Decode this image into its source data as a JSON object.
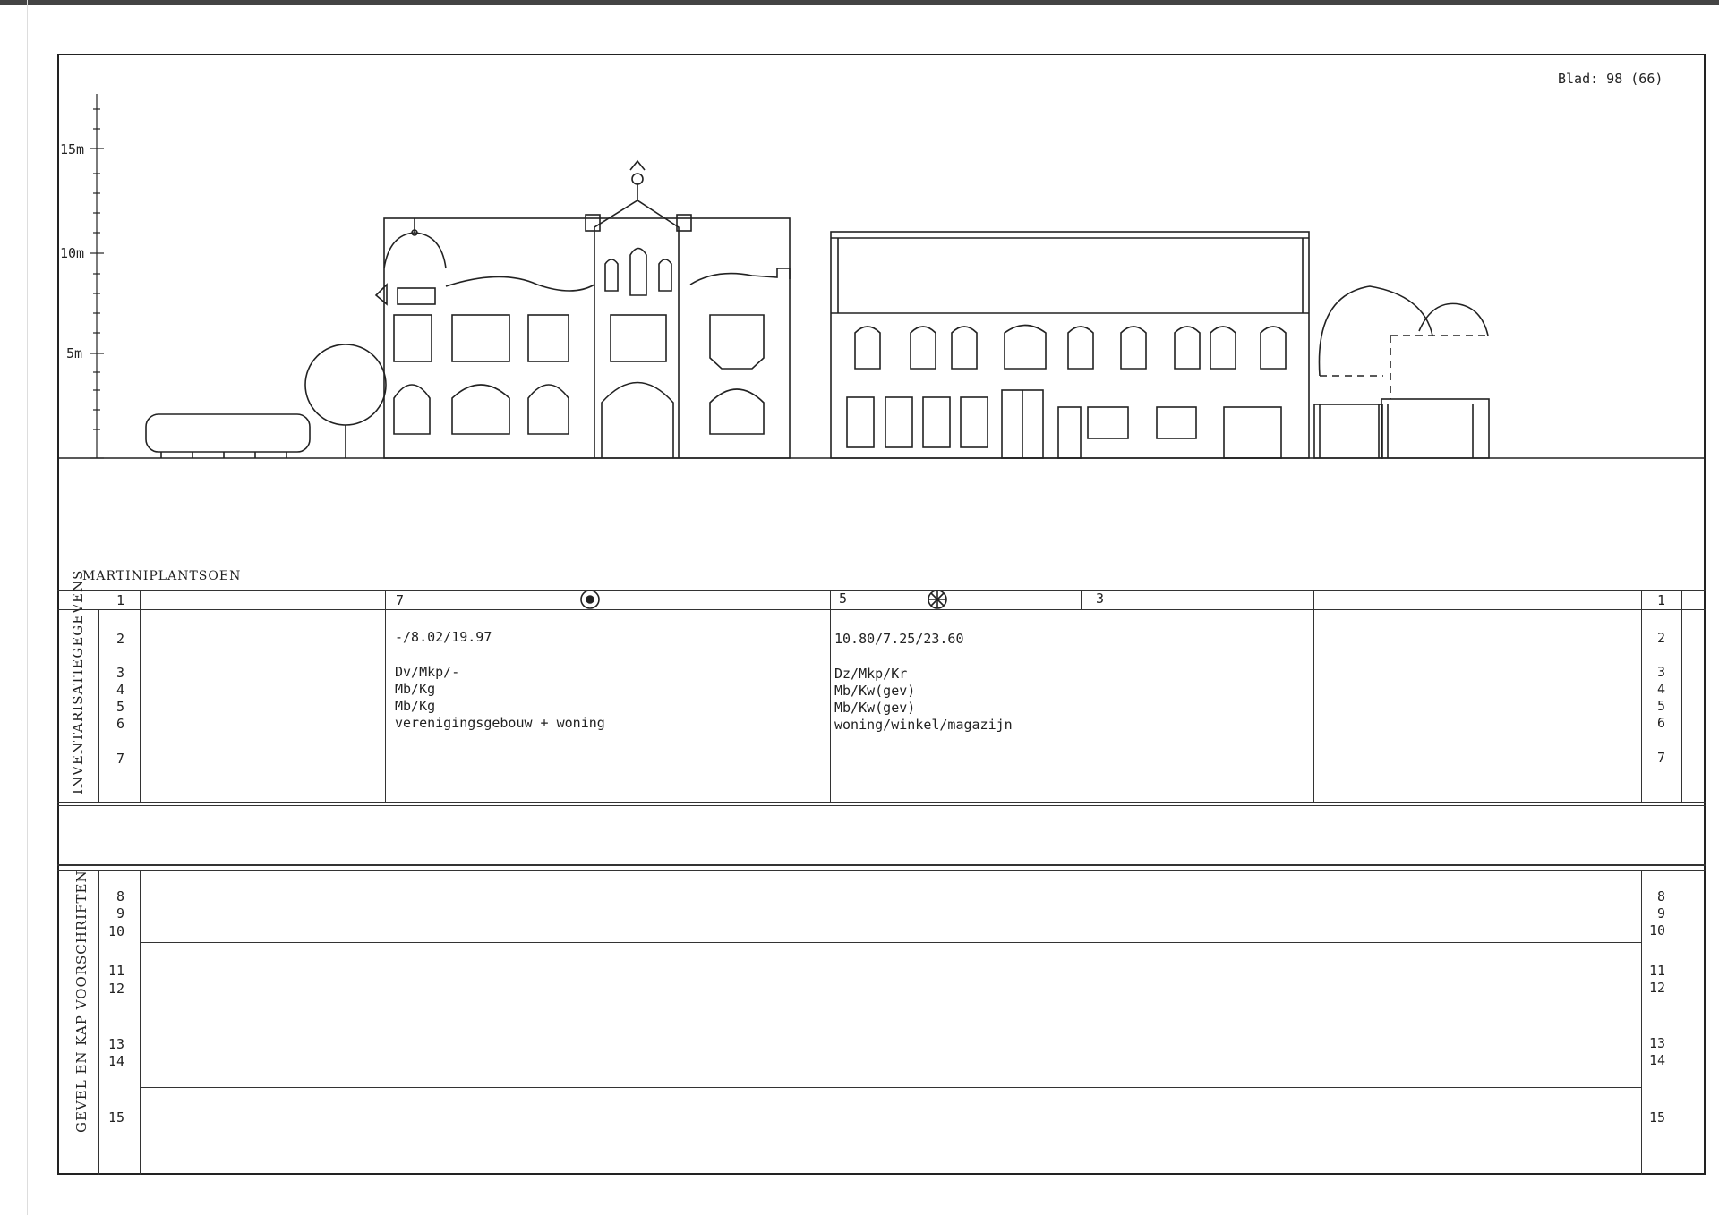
{
  "sheet": {
    "page_label": "Blad: 98 (66)"
  },
  "scale": {
    "labels": [
      "15m",
      "10m",
      "5m"
    ]
  },
  "street": {
    "name": "MARTINIPLANTSOEN"
  },
  "header_row": {
    "left_num": "1",
    "right_num": "1",
    "col_a": "7",
    "col_b": "5",
    "col_c": "3"
  },
  "inventory": {
    "section_title": "INVENTARISATIEGEGEVENS",
    "row_numbers": [
      "2",
      "3",
      "4",
      "5",
      "6",
      "7"
    ],
    "building_a": {
      "line2": "-/8.02/19.97",
      "line3": "Dv/Mkp/-",
      "line4": "Mb/Kg",
      "line5": "Mb/Kg",
      "line6": "verenigingsgebouw + woning"
    },
    "building_b": {
      "line2": "10.80/7.25/23.60",
      "line3": "Dz/Mkp/Kr",
      "line4": "Mb/Kw(gev)",
      "line5": "Mb/Kw(gev)",
      "line6": "woning/winkel/magazijn"
    }
  },
  "regulations": {
    "section_title": "GEVEL EN KAP VOORSCHRIFTEN",
    "groups": [
      [
        "8",
        "9",
        "10"
      ],
      [
        "11",
        "12"
      ],
      [
        "13",
        "14"
      ],
      [
        "15"
      ]
    ]
  },
  "symbols": {
    "a": "bullseye-icon",
    "b": "asterisk-wheel-icon"
  }
}
